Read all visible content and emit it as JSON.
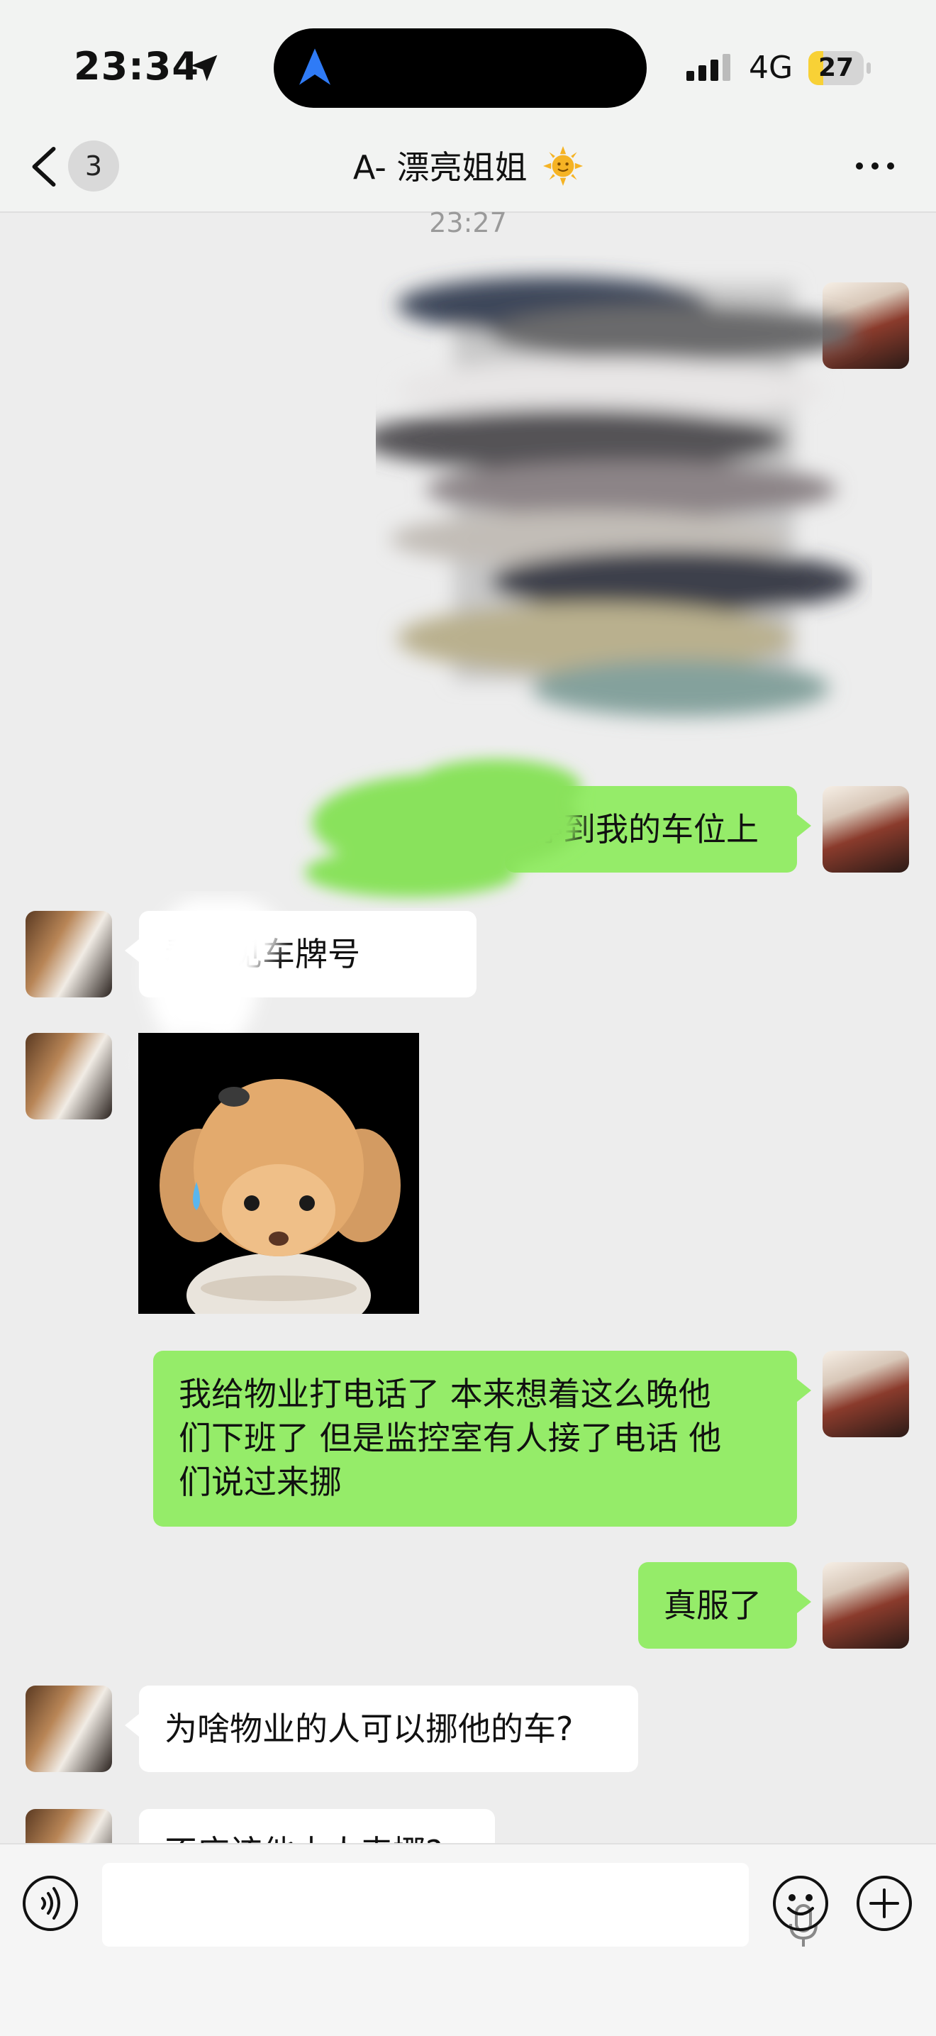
{
  "status": {
    "time": "23:34",
    "network": "4G",
    "battery": "27",
    "battery_level": 0.27
  },
  "header": {
    "back_count": "3",
    "title": "A- 漂亮姐姐"
  },
  "chat": {
    "timestamp": "23:27",
    "messages": [
      {
        "from": "me",
        "type": "image",
        "note": "blurred-image"
      },
      {
        "from": "me",
        "type": "text",
        "text": "停到我的车位上"
      },
      {
        "from": "her",
        "type": "text",
        "text": "看不见车牌号"
      },
      {
        "from": "her",
        "type": "sticker"
      },
      {
        "from": "me",
        "type": "text",
        "lines": [
          "我给物业打电话了 本来想着这么晚他",
          "们下班了 但是监控室有人接了电话 他",
          "们说过来挪"
        ]
      },
      {
        "from": "me",
        "type": "text",
        "text": "真服了"
      },
      {
        "from": "her",
        "type": "text",
        "text": "为啥物业的人可以挪他的车?"
      },
      {
        "from": "her",
        "type": "text",
        "text": "不应该他本人来挪?"
      }
    ]
  },
  "colors": {
    "green_bubble": "#95ec69",
    "background": "#ededed",
    "white_bubble": "#ffffff"
  }
}
